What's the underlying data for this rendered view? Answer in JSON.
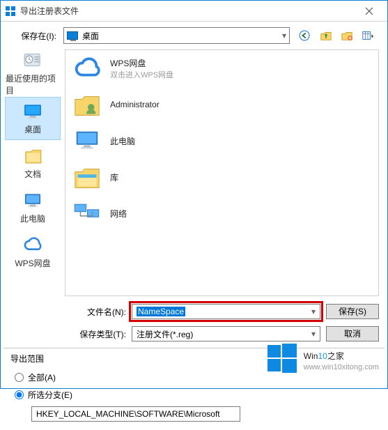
{
  "titlebar": {
    "title": "导出注册表文件"
  },
  "savein": {
    "label": "保存在(I):",
    "value": "桌面"
  },
  "sidebar": {
    "items": [
      {
        "label": "最近使用的项目"
      },
      {
        "label": "桌面"
      },
      {
        "label": "文档"
      },
      {
        "label": "此电脑"
      },
      {
        "label": "WPS网盘"
      }
    ]
  },
  "files": {
    "items": [
      {
        "name": "WPS网盘",
        "sub": "双击进入WPS网盘"
      },
      {
        "name": "Administrator",
        "sub": ""
      },
      {
        "name": "此电脑",
        "sub": ""
      },
      {
        "name": "库",
        "sub": ""
      },
      {
        "name": "网络",
        "sub": ""
      }
    ]
  },
  "fields": {
    "filename_label": "文件名(N):",
    "filename_value": "NameSpace",
    "filetype_label": "保存类型(T):",
    "filetype_value": "注册文件(*.reg)",
    "save_btn": "保存(S)",
    "cancel_btn": "取消"
  },
  "scope": {
    "title": "导出范围",
    "opt_all": "全部(A)",
    "opt_branch": "所选分支(E)",
    "branch_path": "HKEY_LOCAL_MACHINE\\SOFTWARE\\Microsoft"
  },
  "watermark": {
    "brand_a": "Win",
    "brand_b": "10",
    "brand_c": "之家",
    "site": "www.win10xitong.com"
  }
}
